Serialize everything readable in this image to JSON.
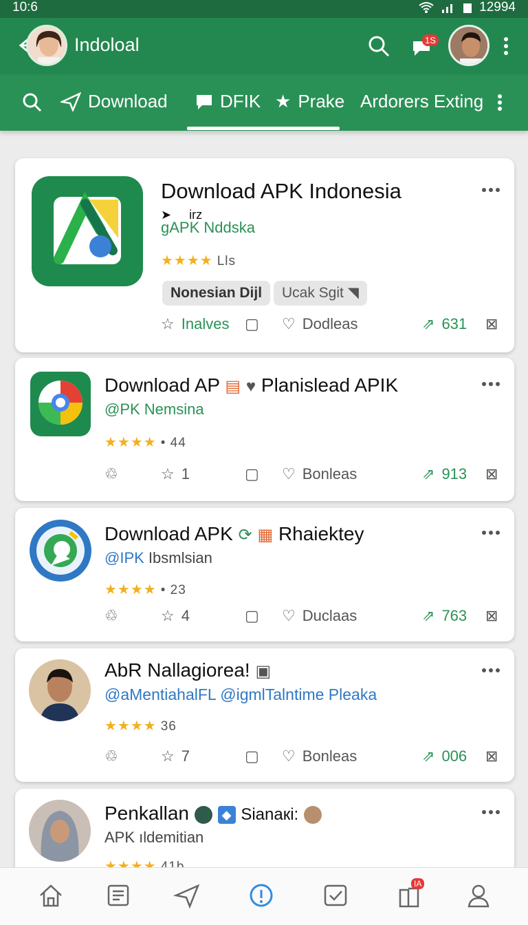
{
  "status_bar": {
    "time": "10:6",
    "battery": "12994"
  },
  "app_bar": {
    "title": "Indoloal",
    "notification_count": "1S"
  },
  "tabs": [
    {
      "label": "Download"
    },
    {
      "label": "DFIK"
    },
    {
      "label": "Prake"
    },
    {
      "label": "Ardorers Exting"
    }
  ],
  "cards": [
    {
      "title": "Download  APK Indonesia",
      "tagline": "irz",
      "subtitle": "gAPK Nddska",
      "rating_meta": "Lls",
      "chips": [
        "Nonesian Dijl",
        "Ucak Sgit"
      ],
      "action_left": "Inalves",
      "action_heart": "Dodleas",
      "share_count": "631"
    },
    {
      "title": "Download AP",
      "title_extra": "Planislead APIK",
      "subtitle": "@PK Nemsina",
      "rating_meta": "• 44",
      "action_star": "1",
      "action_heart": "Bonleas",
      "share_count": "913"
    },
    {
      "title": "Download  APK",
      "title_extra": "Rhaiektey",
      "subtitle": "@IPK",
      "subtitle_extra": "Ibsmlsian",
      "rating_meta": "• 23",
      "action_star": "4",
      "action_heart": "Duclaas",
      "share_count": "763"
    },
    {
      "title": "AbR Nallagiorea!",
      "subtitle": "@aMentiahalFL @igmlTalntime Pleaka",
      "rating_meta": "36",
      "action_star": "7",
      "action_heart": "Bonleas",
      "share_count": "006"
    },
    {
      "title": "Penkallan",
      "title_extra": "Sianaкi:",
      "subtitle": "APK ıldemitian",
      "rating_meta": "41b"
    }
  ],
  "bottom_nav_badge": "IA",
  "colors": {
    "primary": "#23884f",
    "status_bar": "#1d6b3f",
    "star": "#f2b01e",
    "badge": "#e53935"
  }
}
